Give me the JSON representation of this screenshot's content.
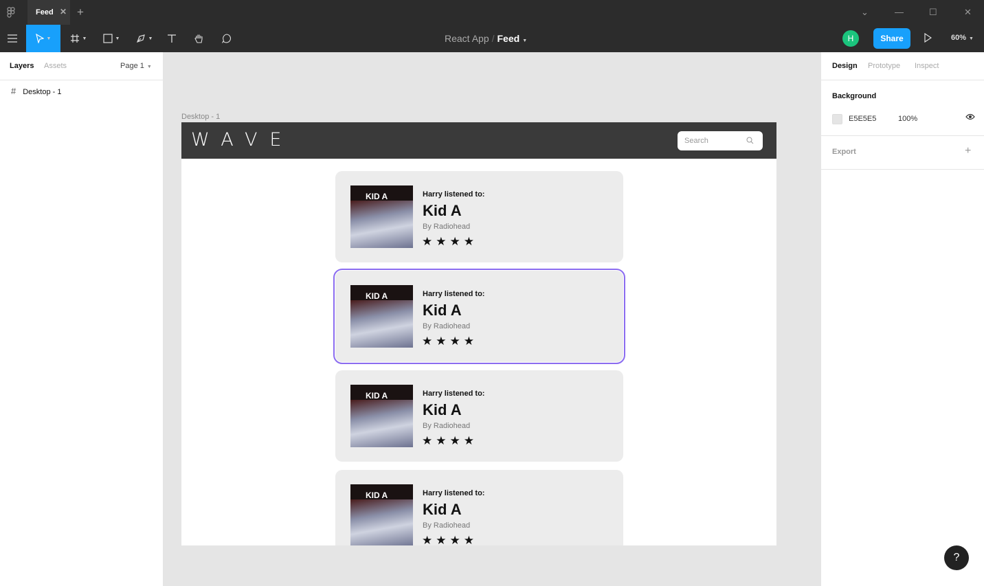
{
  "tabbar": {
    "tab_label": "Feed",
    "close_glyph": "✕",
    "add_glyph": "+",
    "window_controls": [
      "⌄",
      "—",
      "☐",
      "✕"
    ]
  },
  "toolbar": {
    "breadcrumb_project": "React App",
    "breadcrumb_separator": "/",
    "breadcrumb_file": "Feed",
    "avatar_initial": "H",
    "share_label": "Share",
    "zoom_label": "60%",
    "tool_icons": [
      "menu-icon",
      "move-tool-icon",
      "frame-tool-icon",
      "shape-tool-icon",
      "pen-tool-icon",
      "text-tool-icon",
      "hand-tool-icon",
      "comment-tool-icon"
    ],
    "accent_color": "#18a0fb"
  },
  "left_panel": {
    "tabs": [
      "Layers",
      "Assets"
    ],
    "page_selector": "Page 1",
    "layers": [
      {
        "name": "Desktop - 1"
      }
    ]
  },
  "right_panel": {
    "tabs": [
      "Design",
      "Prototype",
      "Inspect"
    ],
    "background_title": "Background",
    "background_hex": "E5E5E5",
    "background_opacity": "100%",
    "export_title": "Export"
  },
  "canvas": {
    "frame_label": "Desktop - 1",
    "app": {
      "logo": "WAVE",
      "search_placeholder": "Search",
      "cards": [
        {
          "who": "Harry listened to:",
          "album": "Kid A",
          "artist": "By Radiohead",
          "cover_text": "KID A",
          "stars": "★★★★"
        },
        {
          "who": "Harry listened to:",
          "album": "Kid A",
          "artist": "By Radiohead",
          "cover_text": "KID A",
          "stars": "★★★★"
        },
        {
          "who": "Harry listened to:",
          "album": "Kid A",
          "artist": "By Radiohead",
          "cover_text": "KID A",
          "stars": "★★★★"
        },
        {
          "who": "Harry listened to:",
          "album": "Kid A",
          "artist": "By Radiohead",
          "cover_text": "KID A",
          "stars": "★★★★"
        }
      ]
    }
  },
  "help_label": "?"
}
